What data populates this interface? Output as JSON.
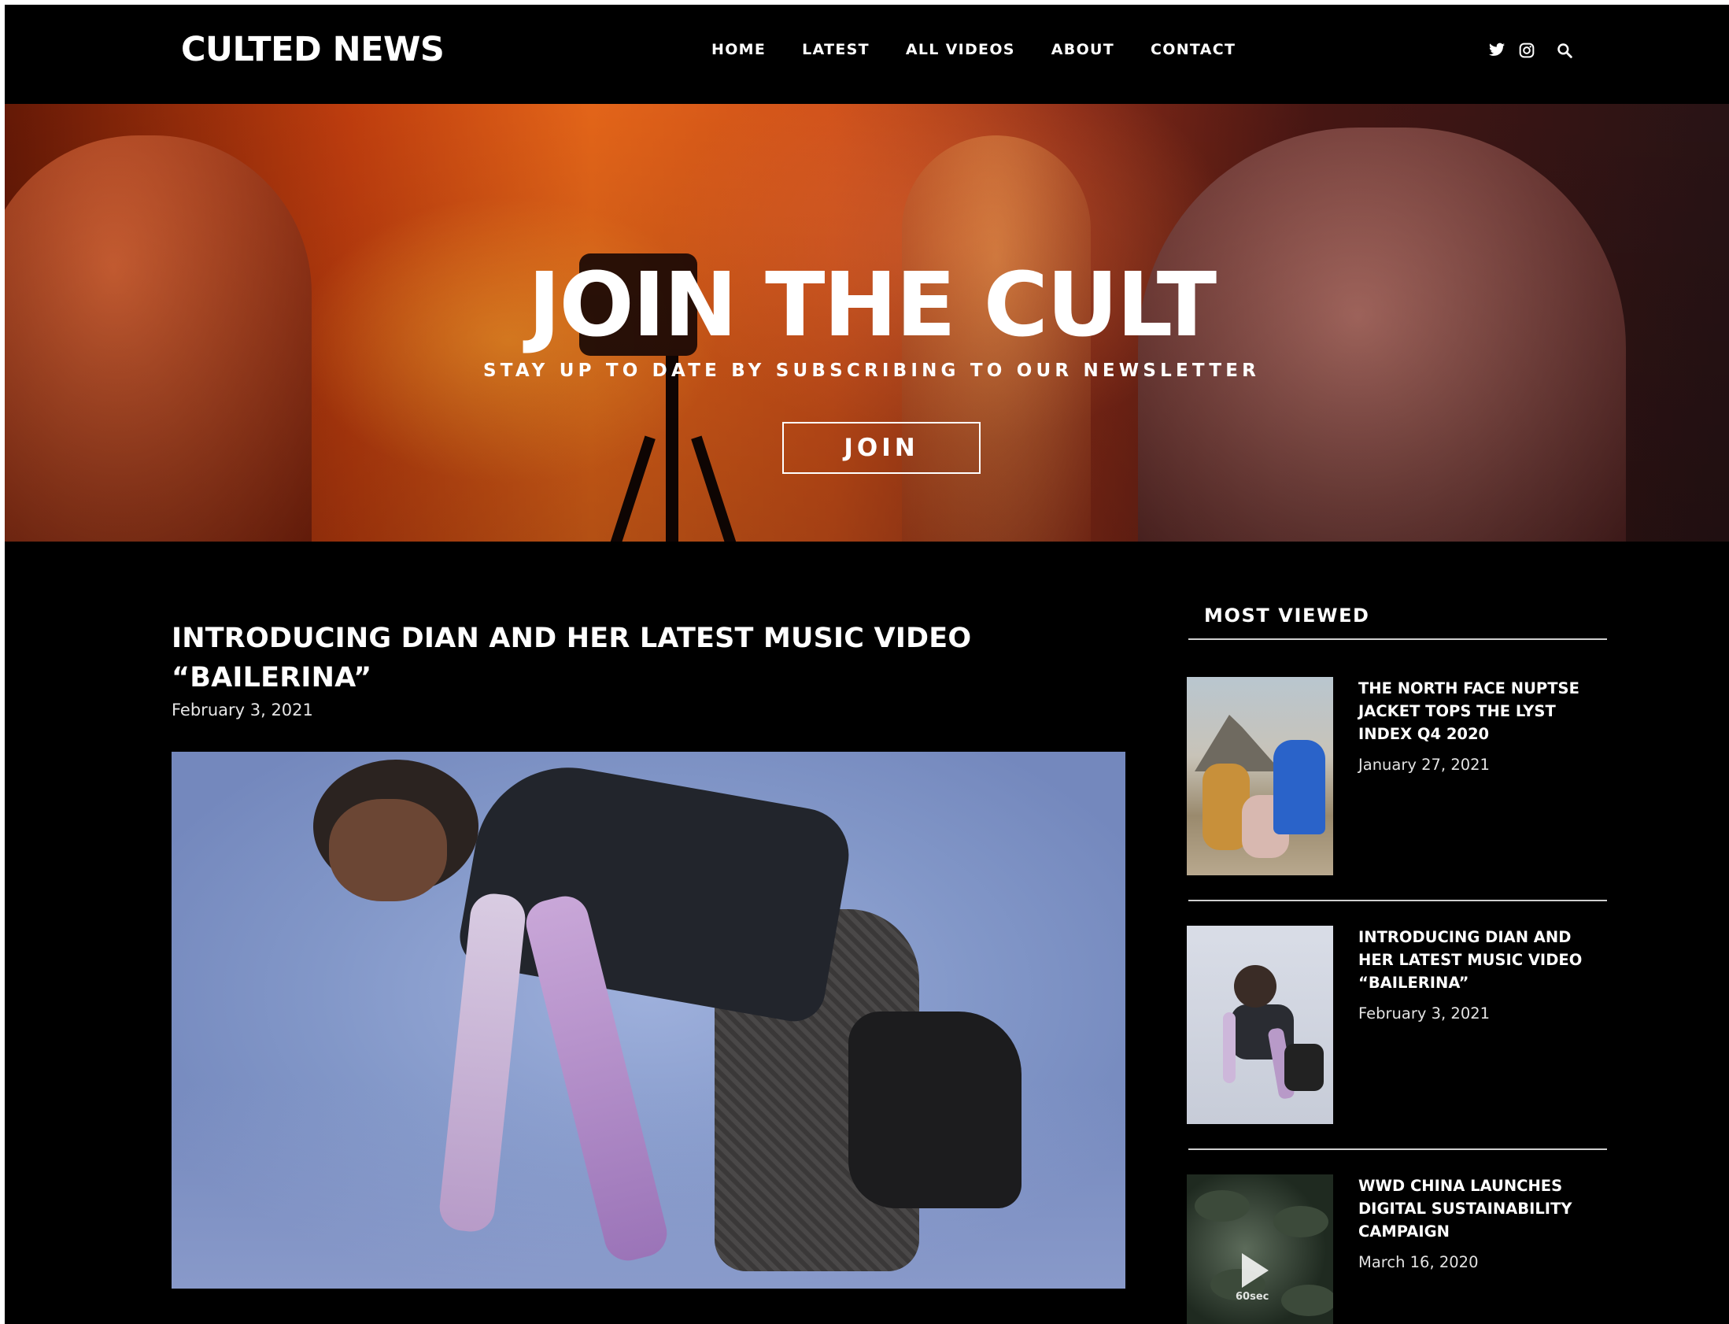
{
  "site": {
    "logo": "CULTED NEWS"
  },
  "nav": {
    "items": [
      "HOME",
      "LATEST",
      "ALL VIDEOS",
      "ABOUT",
      "CONTACT"
    ]
  },
  "header_icons": [
    "twitter-icon",
    "instagram-icon",
    "search-icon"
  ],
  "hero": {
    "title": "JOIN THE CULT",
    "subtitle": "STAY UP TO DATE BY SUBSCRIBING TO OUR NEWSLETTER",
    "button_label": "JOIN"
  },
  "article": {
    "title": "INTRODUCING DIAN AND HER LATEST MUSIC VIDEO “BAILERINA”",
    "date": "February 3, 2021"
  },
  "sidebar": {
    "heading": "MOST VIEWED",
    "items": [
      {
        "title": "THE NORTH FACE NUPTSE JACKET TOPS THE LYST INDEX Q4 2020",
        "date": "January 27, 2021"
      },
      {
        "title": "INTRODUCING DIAN AND HER LATEST MUSIC VIDEO “BAILERINA”",
        "date": "February 3, 2021"
      },
      {
        "title": "WWD CHINA LAUNCHES DIGITAL SUSTAINABILITY CAMPAIGN",
        "date": "March 16, 2020",
        "thumb_badge": "60sec"
      }
    ]
  },
  "colors": {
    "background": "#000000",
    "text": "#ffffff",
    "rule": "#cfcfcf"
  }
}
